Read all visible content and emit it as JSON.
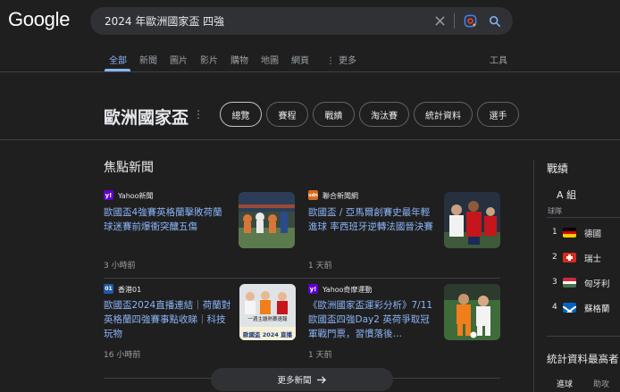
{
  "logo": "Google",
  "search": {
    "query": "2024 年歐洲國家盃 四強"
  },
  "tabs": [
    {
      "label": "全部"
    },
    {
      "label": "新聞"
    },
    {
      "label": "圖片"
    },
    {
      "label": "影片"
    },
    {
      "label": "購物"
    },
    {
      "label": "地圖"
    },
    {
      "label": "網頁"
    },
    {
      "label": "更多"
    }
  ],
  "tools_label": "工具",
  "entity": {
    "title": "歐洲國家盃",
    "chips": [
      "總覽",
      "賽程",
      "戰績",
      "淘汰賽",
      "統計資料",
      "選手"
    ]
  },
  "news": {
    "section_title": "焦點新聞",
    "items": [
      {
        "source": "Yahoo新聞",
        "icon": "y!",
        "headline": "歐國盃4強賽英格蘭擊敗荷蘭 球迷賽前爆衝突釀五傷",
        "time": "3 小時前"
      },
      {
        "source": "聯合新聞網",
        "icon": "udn",
        "headline": "歐國盃 / 亞馬爾創賽史最年輕進球 率西班牙逆轉法國晉決賽",
        "time": "1 天前"
      },
      {
        "source": "香港01",
        "icon": "01",
        "headline": "歐國盃2024直播連結｜荷蘭對英格蘭四強賽事點收睇｜科技玩物",
        "time": "16 小時前"
      },
      {
        "source": "Yahoo奇摩運動",
        "icon": "y!",
        "headline": "《歐洲國家盃運彩分析》7/11歐國盃四強Day2 英荷爭取冠軍戰門票，習慣落後…",
        "time": "1 天前"
      }
    ],
    "thumb3_caption_top": "一週主題熱賽速報",
    "thumb3_caption_bottom": "歐國盃 2024 直播",
    "more_label": "更多新聞"
  },
  "standings": {
    "title": "戰績",
    "group": "A 組",
    "column_header": "球隊",
    "teams": [
      {
        "rank": "1",
        "name": "德國"
      },
      {
        "rank": "2",
        "name": "瑞士"
      },
      {
        "rank": "3",
        "name": "匈牙利"
      },
      {
        "rank": "4",
        "name": "蘇格蘭"
      }
    ]
  },
  "stats": {
    "title": "統計資料最高者",
    "tabs": [
      "進球",
      "助攻"
    ]
  },
  "colors": {
    "background": "#1f1f1f",
    "link": "#8ab4f8",
    "search_bg": "#303134"
  }
}
